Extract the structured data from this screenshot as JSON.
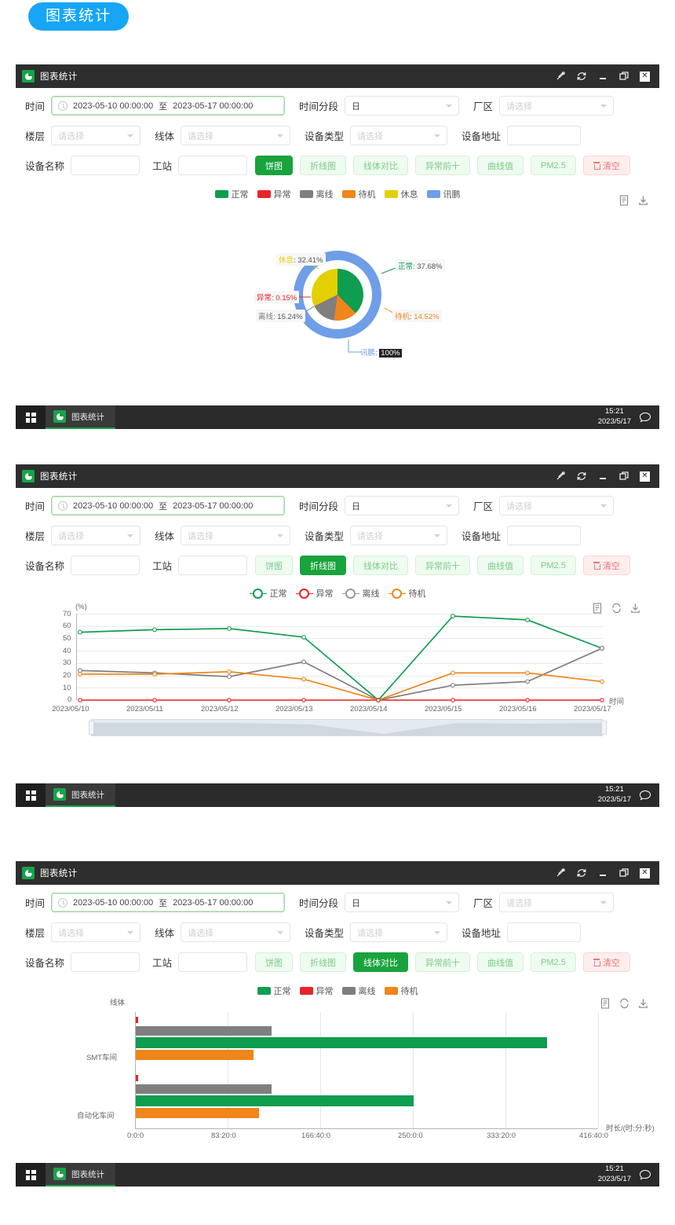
{
  "page": {
    "badge": "图表统计"
  },
  "window": {
    "title": "图表统计",
    "controls": {
      "pin": "pin-icon",
      "refresh": "refresh-icon",
      "minimize": "minimize-icon",
      "maximize": "maximize-icon",
      "close": "close-icon"
    }
  },
  "form": {
    "time_label": "时间",
    "time_start": "2023-05-10 00:00:00",
    "time_to": "至",
    "time_end": "2023-05-17 00:00:00",
    "segment_label": "时间分段",
    "segment_value": "日",
    "plant_label": "厂区",
    "plant_placeholder": "请选择",
    "floor_label": "楼层",
    "floor_placeholder": "请选择",
    "line_label": "线体",
    "line_placeholder": "请选择",
    "device_type_label": "设备类型",
    "device_type_placeholder": "请选择",
    "device_addr_label": "设备地址",
    "device_addr_value": "",
    "device_name_label": "设备名称",
    "device_name_value": "",
    "station_label": "工站",
    "station_value": ""
  },
  "buttons": {
    "pie": "饼图",
    "line": "折线图",
    "compare": "线体对比",
    "top10": "异常前十",
    "curve": "曲线值",
    "pm25": "PM2.5",
    "clear": "清空"
  },
  "tools": {
    "data_view": "data-view-icon",
    "restore": "restore-icon",
    "download": "download-icon"
  },
  "colors": {
    "normal": "#0f9d4f",
    "abnormal": "#e8232a",
    "offline": "#7f7f7f",
    "standby": "#f08519",
    "rest": "#e2d004",
    "xinpeng": "#6f9ee8",
    "accent_green": "#19a33c",
    "badge_blue": "#16a6f5"
  },
  "taskbar": {
    "app_label": "图表统计",
    "time": "15:21",
    "date": "2023/5/17",
    "start": "start-button",
    "chat": "chat-icon"
  },
  "chart_data": [
    {
      "type": "pie",
      "title": "",
      "legend": [
        "正常",
        "异常",
        "离线",
        "待机",
        "休息",
        "讯鹏"
      ],
      "legend_position": "top",
      "inner_ring": {
        "categories": [
          "正常",
          "待机",
          "离线",
          "休息",
          "异常"
        ],
        "values": [
          37.68,
          14.52,
          15.24,
          32.41,
          0.15
        ],
        "unit": "%"
      },
      "outer_ring": {
        "categories": [
          "讯鹏"
        ],
        "values": [
          100
        ],
        "unit": "%"
      },
      "labels": [
        {
          "name": "休息",
          "value": "32.41%",
          "color": "#e2d004"
        },
        {
          "name": "正常",
          "value": "37.68%",
          "color": "#0f9d4f"
        },
        {
          "name": "异常",
          "value": "0.15%",
          "color": "#e8232a"
        },
        {
          "name": "离线",
          "value": "15.24%",
          "color": "#7f7f7f"
        },
        {
          "name": "待机",
          "value": "14.52%",
          "color": "#f08519"
        },
        {
          "name": "讯鹏",
          "value": "100%",
          "color": "#6f9ee8"
        }
      ]
    },
    {
      "type": "line",
      "title": "",
      "ylabel": "(%)",
      "xlabel": "时间",
      "ylim": [
        0,
        70
      ],
      "yticks": [
        0,
        10,
        20,
        30,
        40,
        50,
        60,
        70
      ],
      "grid": true,
      "legend_position": "top",
      "categories": [
        "2023/05/10",
        "2023/05/11",
        "2023/05/12",
        "2023/05/13",
        "2023/05/14",
        "2023/05/15",
        "2023/05/16",
        "2023/05/17"
      ],
      "series": [
        {
          "name": "正常",
          "color": "#0f9d4f",
          "values": [
            55,
            57,
            58,
            51,
            0,
            68,
            65,
            42
          ]
        },
        {
          "name": "异常",
          "color": "#e8232a",
          "values": [
            0,
            0,
            0,
            0,
            0,
            0,
            0,
            0
          ]
        },
        {
          "name": "离线",
          "color": "#7f7f7f",
          "values": [
            24,
            22,
            19,
            31,
            0,
            12,
            15,
            42
          ]
        },
        {
          "name": "待机",
          "color": "#f08519",
          "values": [
            21,
            21,
            23,
            17,
            0,
            22,
            22,
            15
          ]
        }
      ]
    },
    {
      "type": "bar",
      "orientation": "horizontal",
      "title": "",
      "ylabel": "线体",
      "xlabel": "时长/(时:分:秒)",
      "xticks": [
        "0:0:0",
        "83:20:0",
        "166:40:0",
        "250:0:0",
        "333:20:0",
        "416:40:0"
      ],
      "xlim": [
        0,
        416.667
      ],
      "grid": true,
      "legend_position": "top",
      "categories": [
        "SMT车间",
        "自动化车间"
      ],
      "series": [
        {
          "name": "正常",
          "color": "#0f9d4f",
          "values": [
            370,
            250
          ]
        },
        {
          "name": "异常",
          "color": "#e8232a",
          "values": [
            1.5,
            1.5
          ]
        },
        {
          "name": "离线",
          "color": "#7f7f7f",
          "values": [
            122,
            122
          ]
        },
        {
          "name": "待机",
          "color": "#f08519",
          "values": [
            106,
            111
          ]
        }
      ]
    }
  ]
}
